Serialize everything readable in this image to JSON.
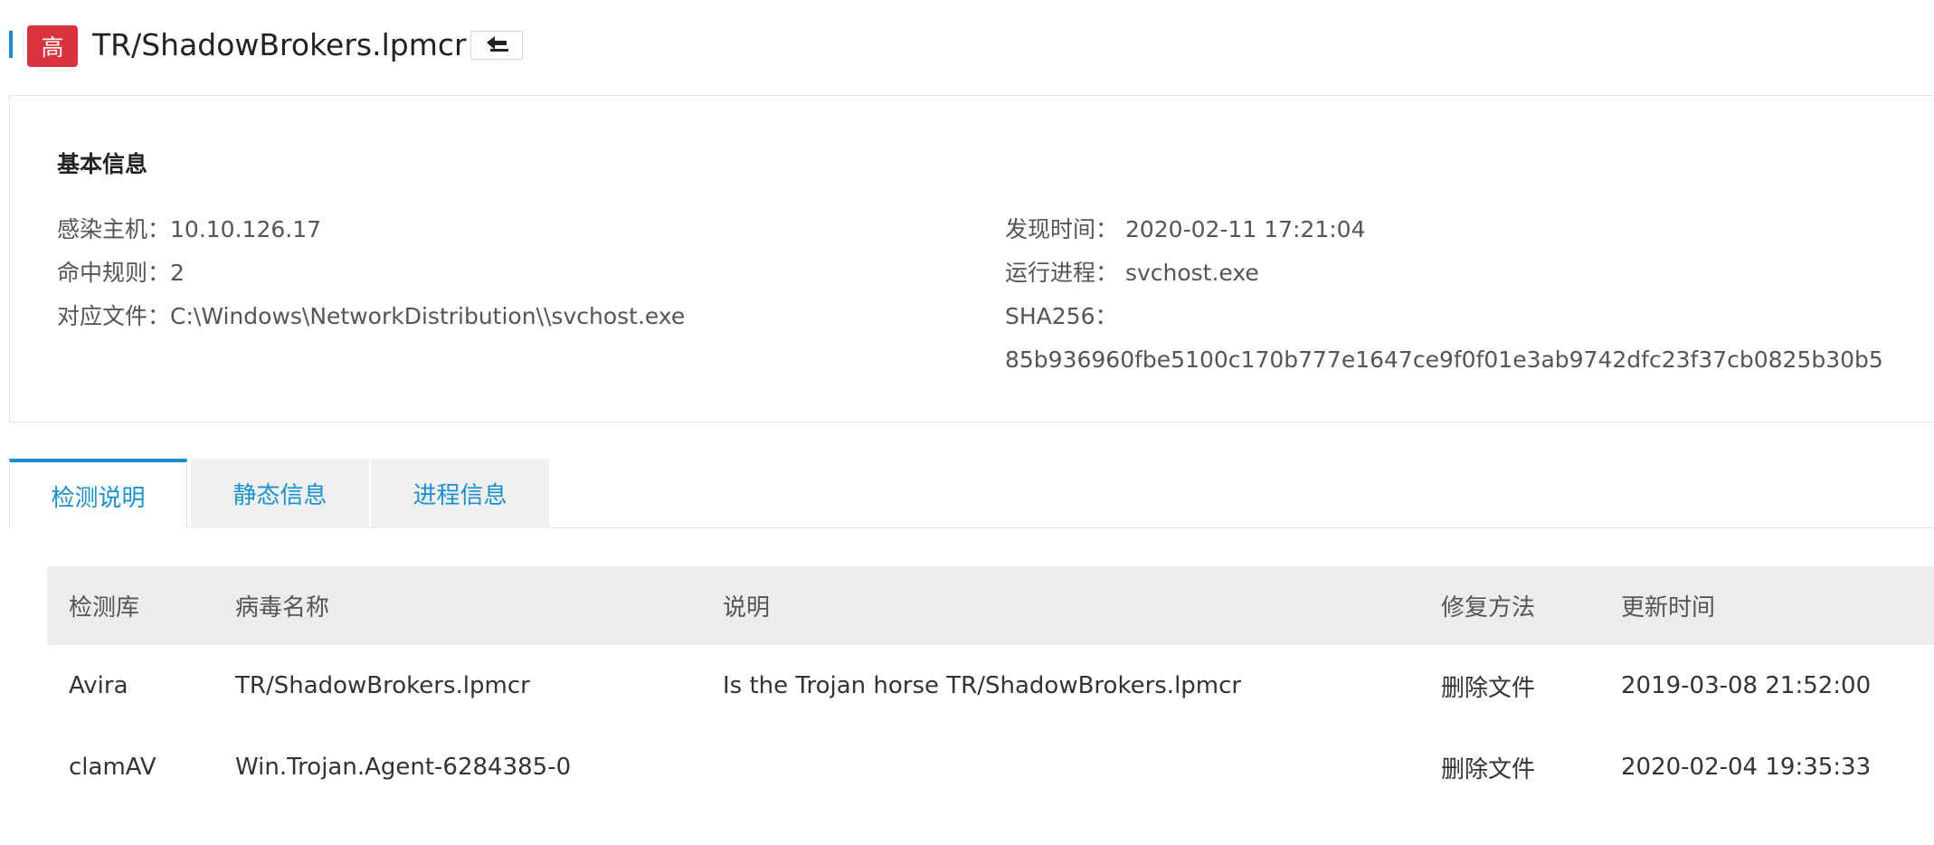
{
  "header": {
    "level_badge": "高",
    "title": "TR/ShadowBrokers.lpmcr",
    "export_icon": "upload-arrow-icon",
    "accent_color": "#1a8fcf",
    "badge_color": "#d9333f"
  },
  "info": {
    "heading": "基本信息",
    "left": [
      {
        "label": "感染主机：",
        "value": "10.10.126.17"
      },
      {
        "label": "命中规则：",
        "value": "2"
      },
      {
        "label": "对应文件：",
        "value": "C:\\Windows\\NetworkDistribution\\\\svchost.exe"
      }
    ],
    "right": [
      {
        "label": "发现时间： ",
        "value": "2020-02-11 17:21:04"
      },
      {
        "label": "运行进程： ",
        "value": "svchost.exe"
      },
      {
        "label": "SHA256：",
        "value": ""
      },
      {
        "label": "",
        "value": "85b936960fbe5100c170b777e1647ce9f0f01e3ab9742dfc23f37cb0825b30b5"
      }
    ]
  },
  "tabs": [
    {
      "label": "检测说明",
      "active": true
    },
    {
      "label": "静态信息",
      "active": false
    },
    {
      "label": "进程信息",
      "active": false
    }
  ],
  "table": {
    "headers": [
      "检测库",
      "病毒名称",
      "说明",
      "修复方法",
      "更新时间"
    ],
    "rows": [
      [
        "Avira",
        "TR/ShadowBrokers.lpmcr",
        "Is the Trojan horse TR/ShadowBrokers.lpmcr",
        "删除文件",
        "2019-03-08 21:52:00"
      ],
      [
        "clamAV",
        "Win.Trojan.Agent-6284385-0",
        "",
        "删除文件",
        "2020-02-04 19:35:33"
      ]
    ]
  }
}
